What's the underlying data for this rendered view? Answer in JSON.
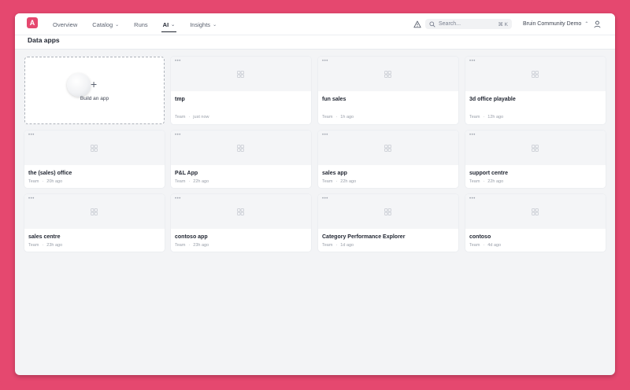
{
  "nav": {
    "logo_text": "A",
    "items": [
      {
        "label": "Overview",
        "chevron": false,
        "active": false
      },
      {
        "label": "Catalog",
        "chevron": true,
        "active": false
      },
      {
        "label": "Runs",
        "chevron": false,
        "active": false
      },
      {
        "label": "AI",
        "chevron": true,
        "active": true
      },
      {
        "label": "Insights",
        "chevron": true,
        "active": false
      }
    ]
  },
  "search": {
    "placeholder": "Search...",
    "shortcut": "⌘ K"
  },
  "workspace": {
    "name": "Bruin Community Demo"
  },
  "page": {
    "title": "Data apps"
  },
  "build_card": {
    "label": "Build an app",
    "plus": "+"
  },
  "apps": [
    {
      "name": "tmp",
      "owner": "Team",
      "time": "just now"
    },
    {
      "name": "fun sales",
      "owner": "Team",
      "time": "1h ago"
    },
    {
      "name": "3d office playable",
      "owner": "Team",
      "time": "12h ago"
    },
    {
      "name": "the (sales) office",
      "owner": "Team",
      "time": "20h ago"
    },
    {
      "name": "P&L App",
      "owner": "Team",
      "time": "22h ago"
    },
    {
      "name": "sales app",
      "owner": "Team",
      "time": "22h ago"
    },
    {
      "name": "support centre",
      "owner": "Team",
      "time": "22h ago"
    },
    {
      "name": "sales centre",
      "owner": "Team",
      "time": "23h ago"
    },
    {
      "name": "contoso app",
      "owner": "Team",
      "time": "23h ago"
    },
    {
      "name": "Category Performance Explorer",
      "owner": "Team",
      "time": "1d ago"
    },
    {
      "name": "contoso",
      "owner": "Team",
      "time": "4d ago"
    }
  ],
  "colors": {
    "accent": "#e5486f",
    "card_bg": "#ffffff",
    "thumb_bg": "#f4f5f7"
  },
  "icons": {
    "logo": "bruin-logo-icon",
    "warning": "warning-triangle-icon",
    "search": "search-icon",
    "user": "user-icon",
    "menu": "more-dots-icon",
    "placeholder": "grid-placeholder-icon"
  }
}
